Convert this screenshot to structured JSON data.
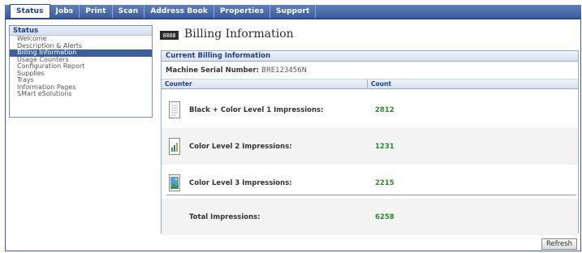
{
  "tabs": [
    "Status",
    "Jobs",
    "Print",
    "Scan",
    "Address Book",
    "Properties",
    "Support"
  ],
  "active_tab": "Status",
  "sidebar": {
    "title": "Status",
    "items": [
      "Welcome",
      "Description & Alerts",
      "Billing Information",
      "Usage Counters",
      "Configuration Report",
      "Supplies",
      "Trays",
      "Information Pages",
      "SMart eSolutions"
    ],
    "selected": "Billing Information"
  },
  "page": {
    "icon_text": "8888",
    "title": "Billing Information"
  },
  "panel": {
    "header": "Current Billing Information",
    "serial_label": "Machine Serial Number:",
    "serial_value": "BRE123456N",
    "col_counter": "Counter",
    "col_count": "Count",
    "rows": [
      {
        "label": "Black + Color Level 1 Impressions:",
        "value": "2812",
        "icon": "document-page-icon"
      },
      {
        "label": "Color Level 2 Impressions:",
        "value": "1231",
        "icon": "bar-chart-document-icon"
      },
      {
        "label": "Color Level 3 Impressions:",
        "value": "2215",
        "icon": "photo-document-icon"
      },
      {
        "label": "Total Impressions:",
        "value": "6258"
      }
    ]
  },
  "refresh_label": "Refresh",
  "colors": {
    "accent": "#3d5e9c",
    "value_green": "#2e8b2e"
  }
}
